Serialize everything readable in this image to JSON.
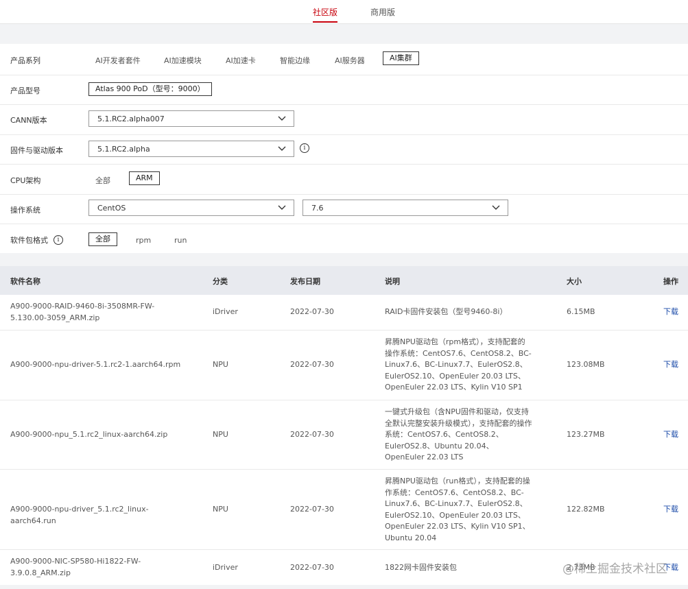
{
  "tabs": [
    {
      "label": "社区版",
      "active": true
    },
    {
      "label": "商用版",
      "active": false
    }
  ],
  "accent_color": "#c7000b",
  "link_color": "#1a4aa8",
  "filters": {
    "product_series": {
      "label": "产品系列",
      "options": [
        "AI开发者套件",
        "AI加速模块",
        "AI加速卡",
        "智能边缘",
        "AI服务器",
        "AI集群"
      ],
      "selected": "AI集群"
    },
    "product_model": {
      "label": "产品型号",
      "options": [
        "Atlas 900 PoD（型号：9000）"
      ],
      "selected": "Atlas 900 PoD（型号：9000）"
    },
    "cann_version": {
      "label": "CANN版本",
      "value": "5.1.RC2.alpha007"
    },
    "firmware_version": {
      "label": "固件与驱动版本",
      "value": "5.1.RC2.alpha",
      "info_icon": "info-icon"
    },
    "cpu_arch": {
      "label": "CPU架构",
      "options": [
        "全部",
        "ARM"
      ],
      "selected": "ARM"
    },
    "os": {
      "label": "操作系统",
      "value": "CentOS",
      "version_value": "7.6"
    },
    "pkg_format": {
      "label": "软件包格式",
      "options": [
        "全部",
        "rpm",
        "run"
      ],
      "selected": "全部",
      "info_icon": "info-icon"
    }
  },
  "table": {
    "headers": {
      "name": "软件名称",
      "category": "分类",
      "date": "发布日期",
      "desc": "说明",
      "size": "大小",
      "op": "操作"
    },
    "rows": [
      {
        "name": "A900-9000-RAID-9460-8i-3508MR-FW-5.130.00-3059_ARM.zip",
        "category": "iDriver",
        "date": "2022-07-30",
        "desc": "RAID卡固件安装包（型号9460-8i）",
        "size": "6.15MB",
        "op": "下载"
      },
      {
        "name": "A900-9000-npu-driver-5.1.rc2-1.aarch64.rpm",
        "category": "NPU",
        "date": "2022-07-30",
        "desc": "昇腾NPU驱动包（rpm格式），支持配套的操作系统：CentOS7.6、CentOS8.2、BC-Linux7.6、BC-Linux7.7、EulerOS2.8、EulerOS2.10、OpenEuler 20.03 LTS、OpenEuler 22.03 LTS、Kylin V10 SP1",
        "size": "123.08MB",
        "op": "下载"
      },
      {
        "name": "A900-9000-npu_5.1.rc2_linux-aarch64.zip",
        "category": "NPU",
        "date": "2022-07-30",
        "desc": "一键式升级包（含NPU固件和驱动，仅支持全默认完整安装升级模式），支持配套的操作系统：CentOS7.6、CentOS8.2、EulerOS2.8、Ubuntu 20.04、OpenEuler 22.03 LTS",
        "size": "123.27MB",
        "op": "下载"
      },
      {
        "name": "A900-9000-npu-driver_5.1.rc2_linux-aarch64.run",
        "category": "NPU",
        "date": "2022-07-30",
        "desc": "昇腾NPU驱动包（run格式），支持配套的操作系统：CentOS7.6、CentOS8.2、BC-Linux7.6、BC-Linux7.7、EulerOS2.8、EulerOS2.10、OpenEuler 20.03 LTS、OpenEuler 22.03 LTS、Kylin V10 SP1、Ubuntu 20.04",
        "size": "122.82MB",
        "op": "下载"
      },
      {
        "name": "A900-9000-NIC-SP580-Hi1822-FW-3.9.0.8_ARM.zip",
        "category": "iDriver",
        "date": "2022-07-30",
        "desc": "1822网卡固件安装包",
        "size": "2.73MB",
        "op": "下载"
      }
    ]
  },
  "watermark": "@稀土掘金技术社区"
}
